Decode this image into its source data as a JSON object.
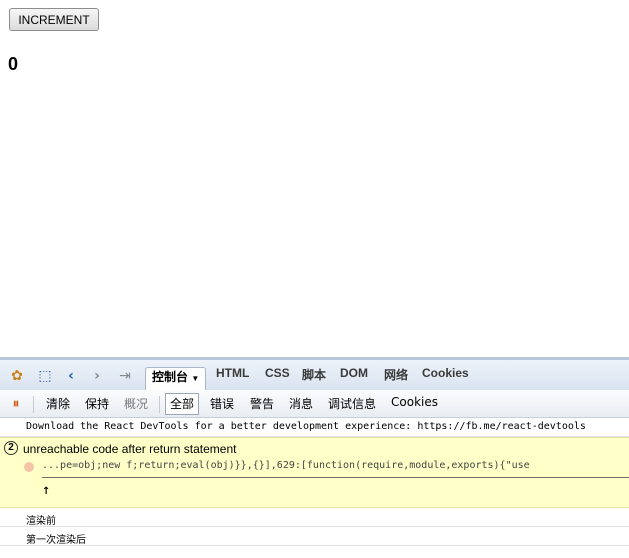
{
  "page": {
    "increment_label": "INCREMENT",
    "count": "0"
  },
  "devtools": {
    "tabs": [
      "控制台",
      "HTML",
      "CSS",
      "脚本",
      "DOM",
      "网络",
      "Cookies"
    ],
    "toolbar": {
      "clear": "清除",
      "persist": "保持",
      "overview": "概况",
      "all": "全部",
      "errors": "错误",
      "warnings": "警告",
      "info": "消息",
      "debug": "调试信息",
      "cookies": "Cookies"
    },
    "logs": {
      "devtools_msg": "Download the React DevTools for a better development experience: https://fb.me/react-devtools",
      "warning_count": "2",
      "warning_title": "unreachable code after return statement",
      "warning_code": "...pe=obj;new f;return;eval(obj)}},{}],629:[function(require,module,exports){\"use",
      "warning_arrow": "↑",
      "render_before": "渲染前",
      "first_render_after": "第一次渲染后"
    }
  }
}
